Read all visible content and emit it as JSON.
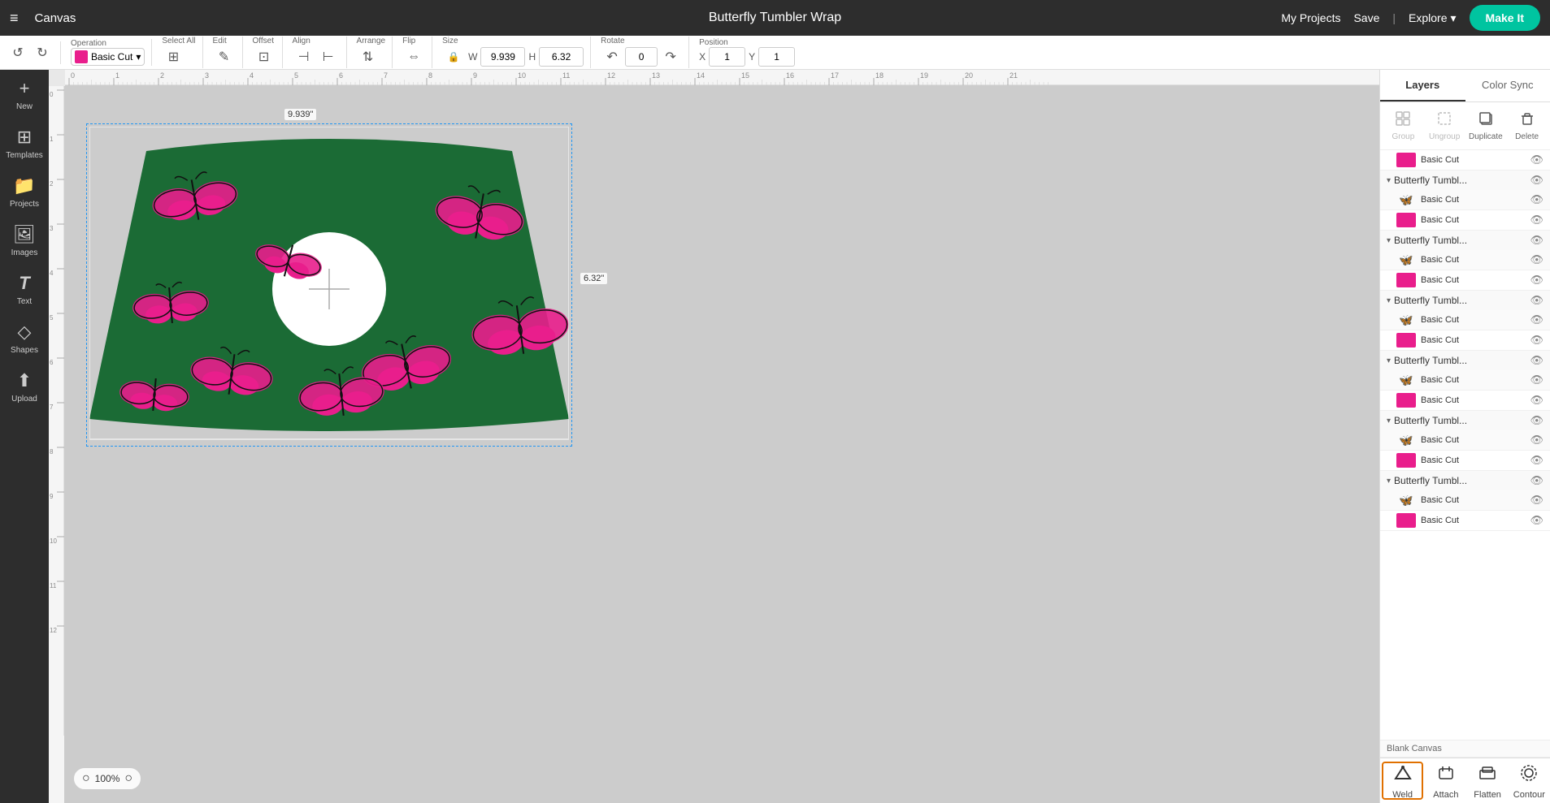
{
  "topbar": {
    "menu_icon": "≡",
    "canvas_label": "Canvas",
    "project_title": "Butterfly Tumbler Wrap",
    "my_projects": "My Projects",
    "save": "Save",
    "separator": "|",
    "explore": "Explore",
    "explore_chevron": "▾",
    "make_it": "Make It"
  },
  "toolbar": {
    "undo_icon": "↺",
    "redo_icon": "↻",
    "operation_label": "Operation",
    "operation_value": "Basic Cut",
    "select_all_label": "Select All",
    "edit_label": "Edit",
    "offset_label": "Offset",
    "align_label": "Align",
    "arrange_label": "Arrange",
    "flip_label": "Flip",
    "size_label": "Size",
    "lock_icon": "🔒",
    "width_label": "W",
    "width_value": "9.939",
    "height_label": "H",
    "height_value": "6.32",
    "rotate_label": "Rotate",
    "position_label": "Position",
    "pos_x": "1",
    "pos_y": "1"
  },
  "sidebar": {
    "items": [
      {
        "id": "new",
        "label": "New",
        "icon": "+"
      },
      {
        "id": "templates",
        "label": "Templates",
        "icon": "⊞"
      },
      {
        "id": "projects",
        "label": "Projects",
        "icon": "📁"
      },
      {
        "id": "images",
        "label": "Images",
        "icon": "🖼"
      },
      {
        "id": "text",
        "label": "Text",
        "icon": "T"
      },
      {
        "id": "shapes",
        "label": "Shapes",
        "icon": "◇"
      },
      {
        "id": "upload",
        "label": "Upload",
        "icon": "⬆"
      }
    ]
  },
  "canvas": {
    "zoom_percent": "100%",
    "dimension_width": "9.939\"",
    "dimension_height": "6.32\"",
    "ruler_marks": [
      "0",
      "1",
      "2",
      "3",
      "4",
      "5",
      "6",
      "7",
      "8",
      "9",
      "10",
      "11",
      "12",
      "13",
      "14",
      "15",
      "16",
      "17",
      "18",
      "19",
      "20",
      "21"
    ]
  },
  "right_panel": {
    "tab_layers": "Layers",
    "tab_color_sync": "Color Sync",
    "group_btn": "Group",
    "ungroup_btn": "Ungroup",
    "duplicate_btn": "Duplicate",
    "delete_btn": "Delete",
    "group_icon": "▣",
    "ungroup_icon": "▢",
    "duplicate_icon": "⧉",
    "delete_icon": "🗑",
    "layers": [
      {
        "type": "item",
        "name": "Basic Cut",
        "thumb_type": "pink",
        "visible": true
      },
      {
        "type": "group",
        "name": "Butterfly Tumbl...",
        "visible": true
      },
      {
        "type": "item",
        "name": "Basic Cut",
        "thumb_type": "butterfly",
        "visible": true
      },
      {
        "type": "item",
        "name": "Basic Cut",
        "thumb_type": "pink",
        "visible": true
      },
      {
        "type": "group",
        "name": "Butterfly Tumbl...",
        "visible": true
      },
      {
        "type": "item",
        "name": "Basic Cut",
        "thumb_type": "butterfly",
        "visible": true
      },
      {
        "type": "item",
        "name": "Basic Cut",
        "thumb_type": "pink",
        "visible": true
      },
      {
        "type": "group",
        "name": "Butterfly Tumbl...",
        "visible": true
      },
      {
        "type": "item",
        "name": "Basic Cut",
        "thumb_type": "butterfly",
        "visible": true
      },
      {
        "type": "item",
        "name": "Basic Cut",
        "thumb_type": "pink",
        "visible": true
      },
      {
        "type": "group",
        "name": "Butterfly Tumbl...",
        "visible": true
      },
      {
        "type": "item",
        "name": "Basic Cut",
        "thumb_type": "butterfly",
        "visible": true
      },
      {
        "type": "item",
        "name": "Basic Cut",
        "thumb_type": "pink",
        "visible": true
      },
      {
        "type": "group",
        "name": "Butterfly Tumbl...",
        "visible": true
      },
      {
        "type": "item",
        "name": "Basic Cut",
        "thumb_type": "butterfly",
        "visible": true
      },
      {
        "type": "item",
        "name": "Basic Cut",
        "thumb_type": "pink",
        "visible": true
      },
      {
        "type": "group",
        "name": "Butterfly Tumbl...",
        "visible": true
      },
      {
        "type": "item",
        "name": "Basic Cut",
        "thumb_type": "butterfly",
        "visible": true
      },
      {
        "type": "item",
        "name": "Basic Cut",
        "thumb_type": "pink",
        "visible": true
      }
    ],
    "blank_canvas_label": "Blank Canvas"
  },
  "bottom_panel": {
    "weld_label": "Weld",
    "attach_label": "Attach",
    "flatten_label": "Flatten",
    "contour_label": "Contour",
    "weld_icon": "⬡",
    "attach_icon": "📎",
    "flatten_icon": "⬜",
    "contour_icon": "◌"
  }
}
